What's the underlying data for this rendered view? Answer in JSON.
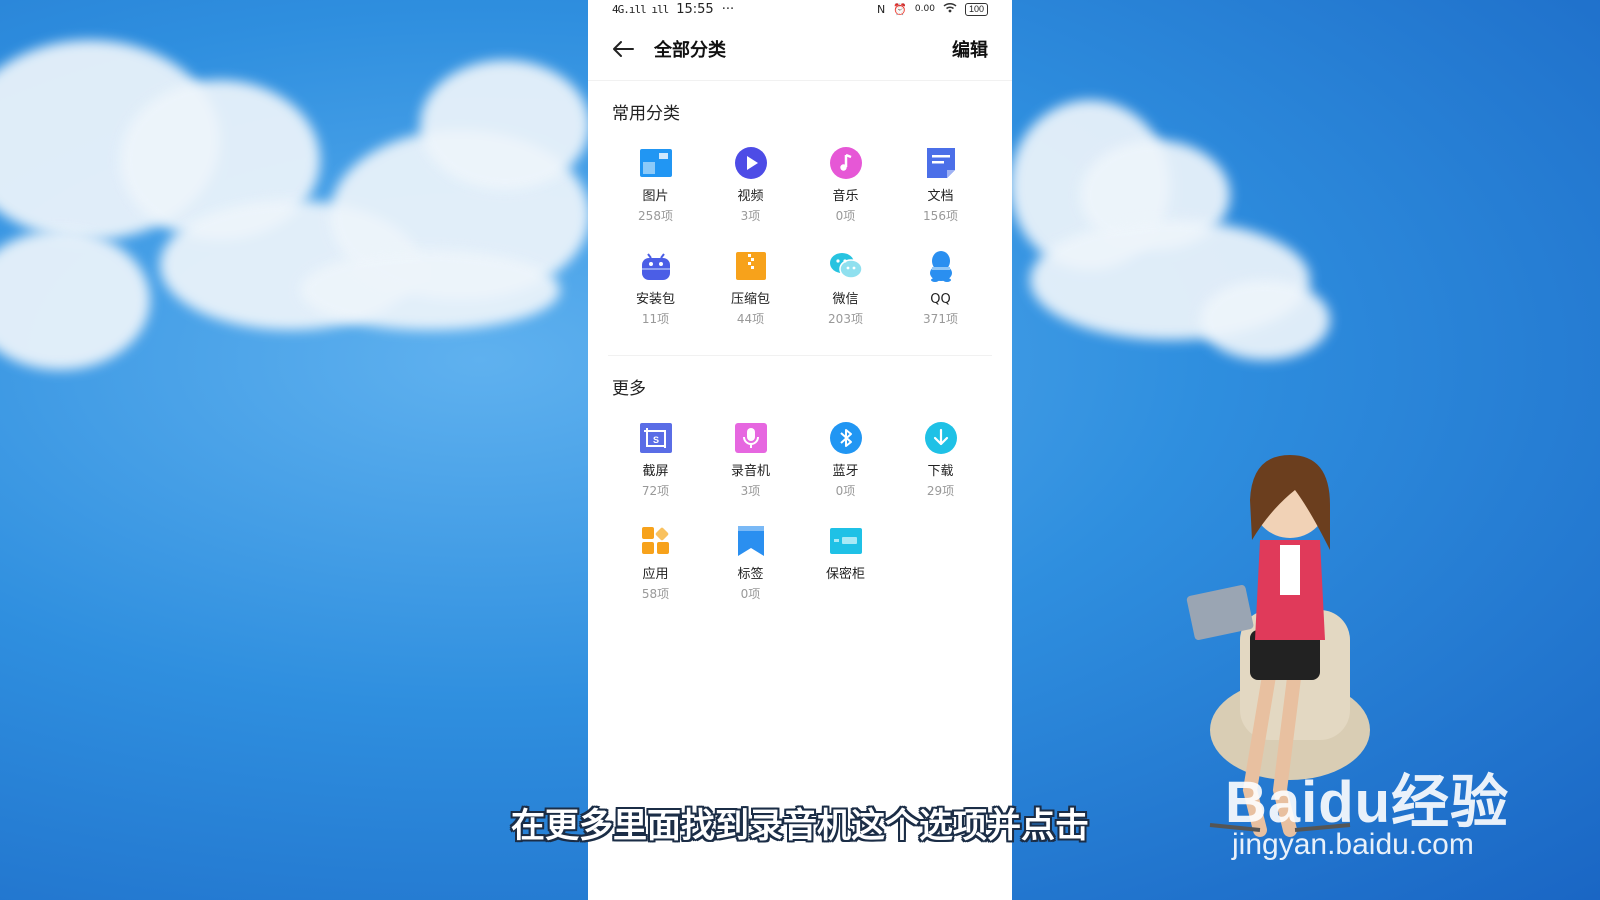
{
  "status_bar": {
    "signal_text": "4G.ıll ıll",
    "time": "15:55",
    "more": "···",
    "net_speed": "0.00",
    "battery": "100"
  },
  "app_bar": {
    "title": "全部分类",
    "edit_label": "编辑"
  },
  "sections": {
    "common": {
      "title": "常用分类",
      "items": [
        {
          "label": "图片",
          "count": "258项",
          "icon": "image-icon",
          "color": "#2196f3"
        },
        {
          "label": "视频",
          "count": "3项",
          "icon": "video-play-icon",
          "color": "#4d4ce6"
        },
        {
          "label": "音乐",
          "count": "0项",
          "icon": "music-icon",
          "color": "#e657d6"
        },
        {
          "label": "文档",
          "count": "156项",
          "icon": "document-icon",
          "color": "#4b6fe8"
        },
        {
          "label": "安装包",
          "count": "11项",
          "icon": "android-package-icon",
          "color": "#4b5ee6"
        },
        {
          "label": "压缩包",
          "count": "44项",
          "icon": "zip-archive-icon",
          "color": "#f7a21b"
        },
        {
          "label": "微信",
          "count": "203项",
          "icon": "wechat-icon",
          "color": "#27c3e0"
        },
        {
          "label": "QQ",
          "count": "371项",
          "icon": "qq-icon",
          "color": "#2a8ff0"
        }
      ]
    },
    "more": {
      "title": "更多",
      "items": [
        {
          "label": "截屏",
          "count": "72项",
          "icon": "screenshot-icon",
          "color": "#5a6de6"
        },
        {
          "label": "录音机",
          "count": "3项",
          "icon": "recorder-icon",
          "color": "#e667e0"
        },
        {
          "label": "蓝牙",
          "count": "0项",
          "icon": "bluetooth-icon",
          "color": "#2196f3"
        },
        {
          "label": "下载",
          "count": "29项",
          "icon": "download-icon",
          "color": "#1fc1e6"
        },
        {
          "label": "应用",
          "count": "58项",
          "icon": "apps-icon",
          "color": "#f7a21b"
        },
        {
          "label": "标签",
          "count": "0项",
          "icon": "bookmark-tag-icon",
          "color": "#2a8ff0"
        },
        {
          "label": "保密柜",
          "count": "",
          "icon": "safe-box-icon",
          "color": "#1fc1e6"
        }
      ]
    }
  },
  "subtitle": "在更多里面找到录音机这个选项并点击",
  "watermark": {
    "logo": "Baidu经验",
    "site": "jingyan.baidu.com"
  }
}
